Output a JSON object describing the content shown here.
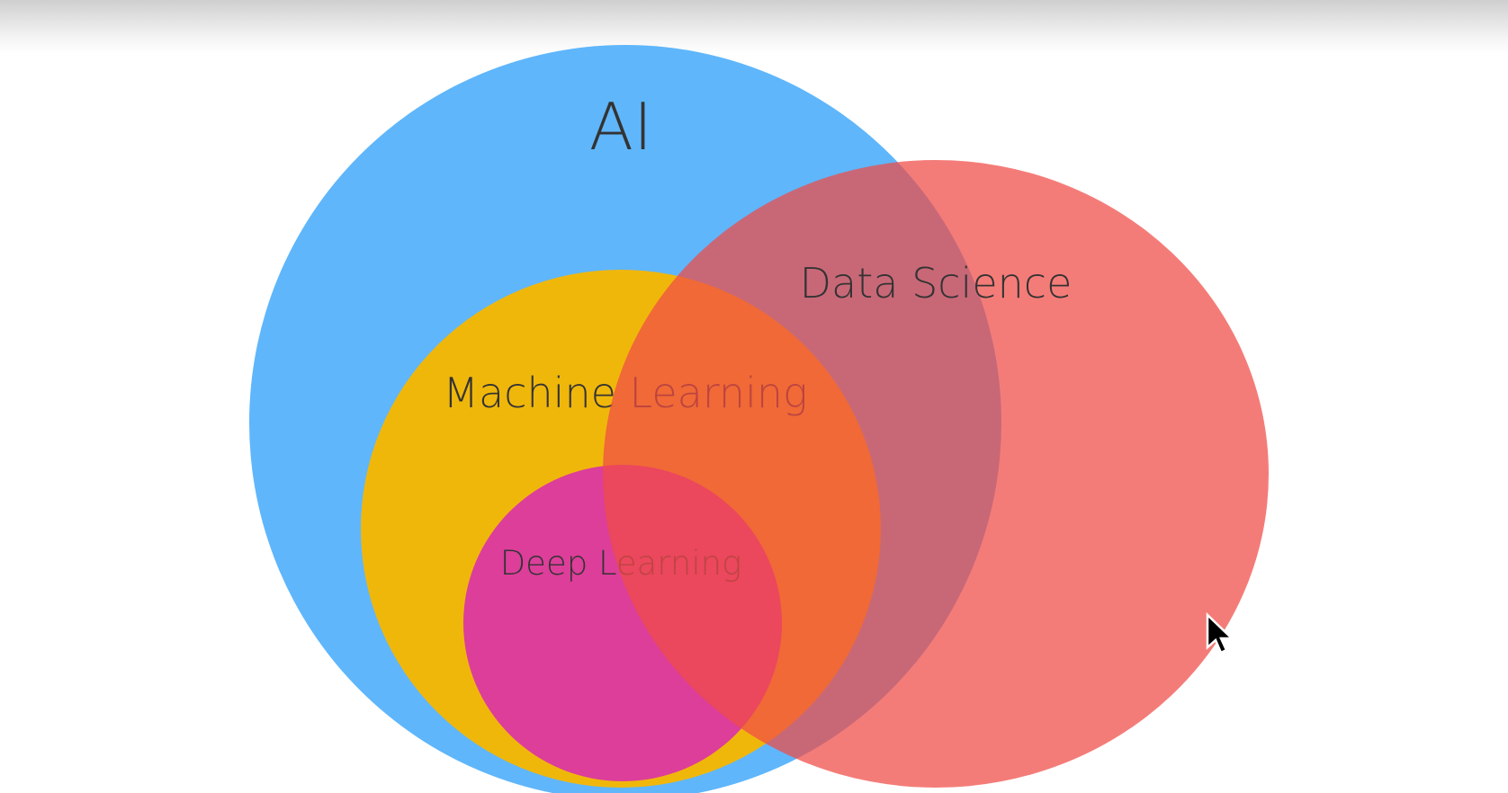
{
  "diagram": {
    "type": "venn",
    "sets": [
      {
        "id": "ai",
        "label": "AI",
        "color": "#5fb6fb"
      },
      {
        "id": "ml",
        "label": "Machine Learning",
        "color": "#f0b70b",
        "inside": "ai"
      },
      {
        "id": "dl",
        "label": "Deep Learning",
        "color": "#dc3e9a",
        "inside": "ml"
      },
      {
        "id": "ds",
        "label": "Data Science",
        "color": "#f04b46",
        "opacity": 0.73,
        "overlaps": [
          "ai",
          "ml",
          "dl"
        ]
      }
    ],
    "text_color": "#333333"
  }
}
